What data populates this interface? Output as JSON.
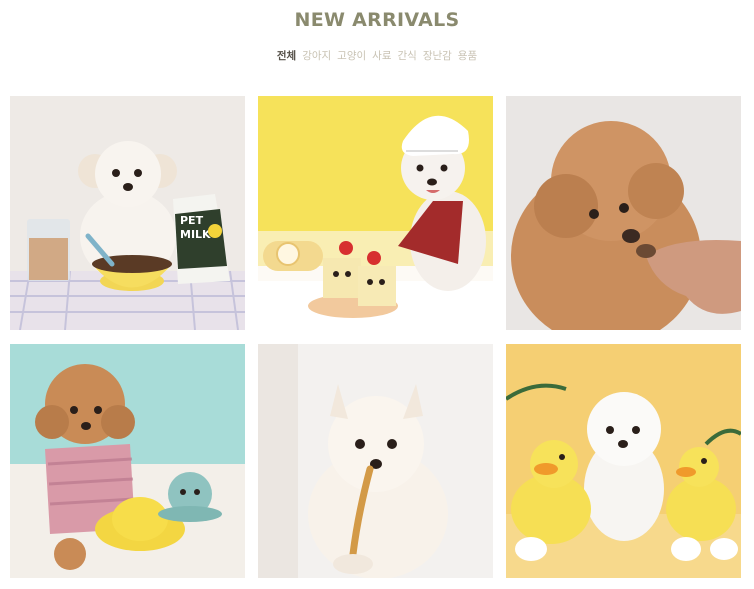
{
  "section": {
    "title": "NEW ARRIVALS"
  },
  "tabs": [
    {
      "label": "전체",
      "active": true
    },
    {
      "label": "강아지",
      "active": false
    },
    {
      "label": "고양이",
      "active": false
    },
    {
      "label": "사료",
      "active": false
    },
    {
      "label": "간식",
      "active": false
    },
    {
      "label": "장난감",
      "active": false
    },
    {
      "label": "용품",
      "active": false
    }
  ],
  "products": [
    {
      "image": "dog-with-pet-milk",
      "package_text_1": "PET",
      "package_text_2": "MILK",
      "background": "#eeeae6"
    },
    {
      "image": "dog-chef-with-cake",
      "background": "#f6e25a"
    },
    {
      "image": "poodle-eating-treat",
      "background": "#e9e6e4"
    },
    {
      "image": "poodle-with-octopus-toy",
      "background": "#a8dcd8"
    },
    {
      "image": "pomeranian-with-chew-stick",
      "background": "#f3f1ef"
    },
    {
      "image": "bichon-with-duck-toys",
      "background": "#f5cf73"
    }
  ],
  "colors": {
    "title": "#8a8a6e",
    "tab_active": "#555048",
    "tab_inactive": "#c9c3b4"
  }
}
